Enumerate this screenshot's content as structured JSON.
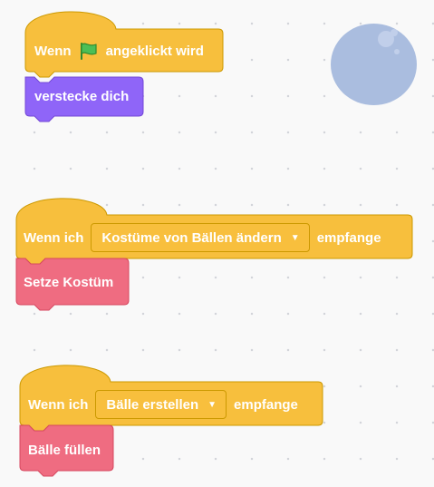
{
  "colors": {
    "events": "#f7bf3d",
    "events_border": "#cc9900",
    "looks": "#8f65f8",
    "looks_border": "#7348d6",
    "custom": "#ef6c81",
    "custom_border": "#d6485f",
    "sprite_ghost": "#aabddf"
  },
  "scripts": [
    {
      "hat": {
        "prefix": "Wenn",
        "icon": "green-flag-icon",
        "suffix": "angeklickt wird"
      },
      "stack": {
        "label": "verstecke dich",
        "category": "looks"
      }
    },
    {
      "hat": {
        "prefix": "Wenn ich",
        "dropdown": "Kostüme von Bällen ändern",
        "suffix": "empfange"
      },
      "stack": {
        "label": "Setze Kostüm",
        "category": "custom"
      }
    },
    {
      "hat": {
        "prefix": "Wenn ich",
        "dropdown": "Bälle erstellen",
        "suffix": "empfange"
      },
      "stack": {
        "label": "Bälle füllen",
        "category": "custom"
      }
    }
  ]
}
